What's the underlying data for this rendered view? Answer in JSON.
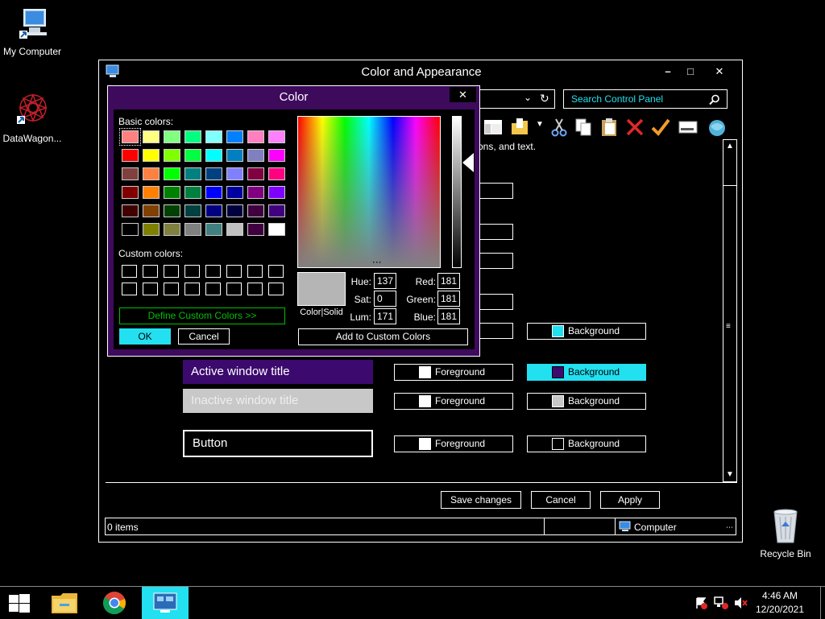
{
  "desktop": {
    "icons": [
      {
        "label": "My Computer"
      },
      {
        "label": "DataWagon..."
      },
      {
        "label": "Recycle Bin"
      }
    ]
  },
  "window": {
    "title": "Color and Appearance",
    "search_placeholder": "Search Control Panel",
    "description_fragment": "ons, and text.",
    "preview": {
      "active_title": "Active window title",
      "inactive_title": "Inactive window title",
      "button_text": "Button"
    },
    "color_buttons": {
      "foreground": "Foreground",
      "background": "Background"
    },
    "buttons": {
      "save": "Save changes",
      "cancel": "Cancel",
      "apply": "Apply"
    },
    "status": {
      "items": "0 items",
      "location": "Computer"
    }
  },
  "color_dialog": {
    "title": "Color",
    "basic_label": "Basic colors:",
    "custom_label": "Custom colors:",
    "define_custom": "Define Custom Colors >>",
    "ok": "OK",
    "cancel": "Cancel",
    "add_custom": "Add to Custom Colors",
    "color_solid": "Color|Solid",
    "selected_color": "#b5b5b5",
    "fields": {
      "hue_label": "Hue:",
      "hue": "137",
      "sat_label": "Sat:",
      "sat": "0",
      "lum_label": "Lum:",
      "lum": "171",
      "red_label": "Red:",
      "red": "181",
      "green_label": "Green:",
      "green": "181",
      "blue_label": "Blue:",
      "blue": "181"
    },
    "basic_colors": [
      "#ff8080",
      "#ffff80",
      "#80ff80",
      "#00ff80",
      "#80ffff",
      "#0080ff",
      "#ff80c0",
      "#ff80ff",
      "#ff0000",
      "#ffff00",
      "#80ff00",
      "#00ff40",
      "#00ffff",
      "#0080c0",
      "#8080c0",
      "#ff00ff",
      "#804040",
      "#ff8040",
      "#00ff00",
      "#008080",
      "#004080",
      "#8080ff",
      "#800040",
      "#ff0080",
      "#800000",
      "#ff8000",
      "#008000",
      "#008040",
      "#0000ff",
      "#0000a0",
      "#800080",
      "#8000ff",
      "#400000",
      "#804000",
      "#004000",
      "#004040",
      "#000080",
      "#000040",
      "#400040",
      "#400080",
      "#000000",
      "#808000",
      "#808040",
      "#808080",
      "#408080",
      "#c0c0c0",
      "#400040",
      "#ffffff"
    ]
  },
  "taskbar": {
    "time": "4:46 AM",
    "date": "12/20/2021"
  },
  "colors": {
    "accent_cyan": "#22e0f0",
    "dialog_purple": "#3e0a5c",
    "active_title_bg": "#3c0a6e",
    "inactive_title_bg": "#c8c8c8",
    "define_green": "#00c000"
  }
}
